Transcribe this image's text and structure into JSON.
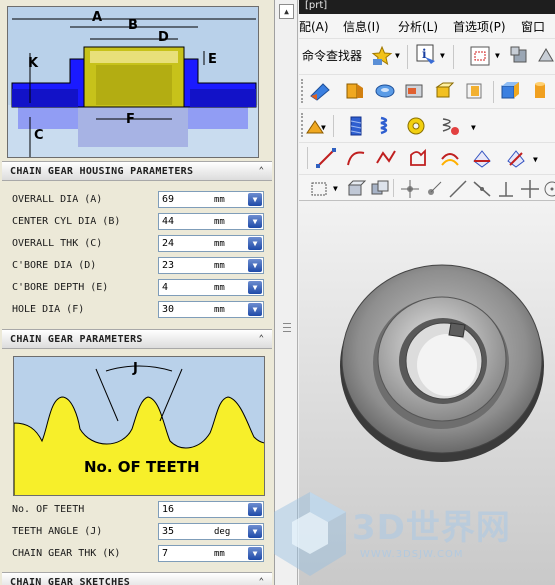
{
  "title_fragment": "[prt]",
  "menubar": {
    "items": [
      "配(A)",
      "信息(I)",
      "分析(L)",
      "首选项(P)",
      "窗口"
    ]
  },
  "toolbar": {
    "finder_label": "命令查找器"
  },
  "housing_diagram": {
    "dims": [
      "A",
      "B",
      "D",
      "E",
      "K",
      "C",
      "F"
    ]
  },
  "housing_section": {
    "title": "CHAIN GEAR HOUSING PARAMETERS",
    "params": [
      {
        "label": "OVERALL DIA (A)",
        "value": "69",
        "unit": "mm"
      },
      {
        "label": "CENTER CYL DIA (B)",
        "value": "44",
        "unit": "mm"
      },
      {
        "label": "OVERALL THK (C)",
        "value": "24",
        "unit": "mm"
      },
      {
        "label": "C'BORE DIA (D)",
        "value": "23",
        "unit": "mm"
      },
      {
        "label": "C'BORE DEPTH (E)",
        "value": "4",
        "unit": "mm"
      },
      {
        "label": "HOLE DIA (F)",
        "value": "30",
        "unit": "mm"
      }
    ]
  },
  "gear_section": {
    "title": "CHAIN GEAR PARAMETERS",
    "diagram_dim": "J",
    "diagram_caption": "No. OF TEETH",
    "params": [
      {
        "label": "No. OF TEETH",
        "value": "16",
        "unit": ""
      },
      {
        "label": "TEETH ANGLE (J)",
        "value": "35",
        "unit": "deg"
      },
      {
        "label": "CHAIN GEAR THK (K)",
        "value": "7",
        "unit": "mm"
      }
    ]
  },
  "sketch_section": {
    "title": "CHAIN GEAR SKETCHES"
  },
  "watermark": {
    "text": "3D世界网",
    "url": "WWW.3DSJW.COM"
  }
}
